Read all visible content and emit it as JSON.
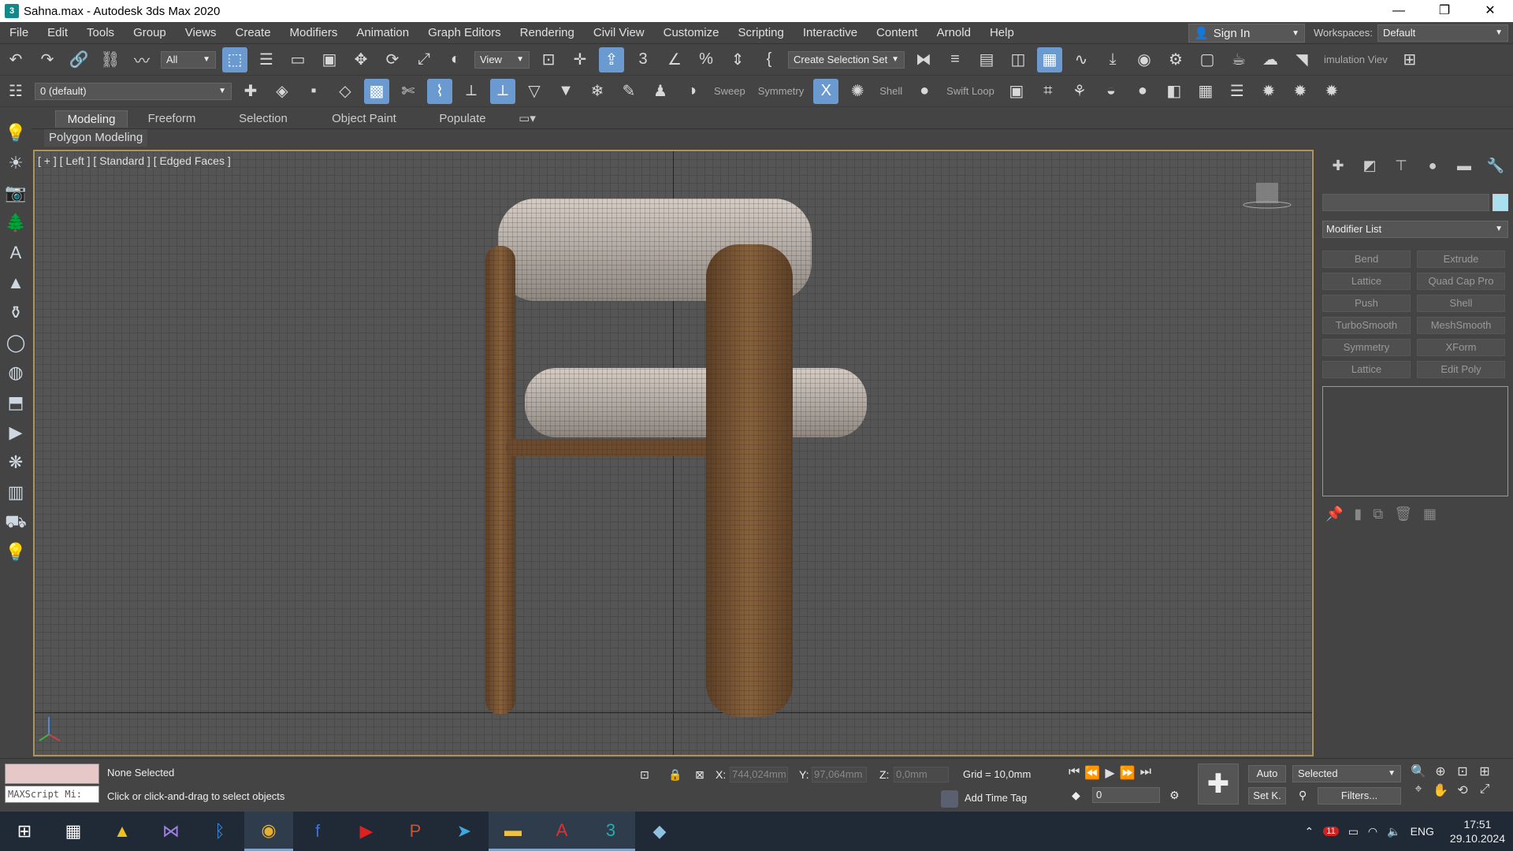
{
  "window": {
    "title": "Sahna.max - Autodesk 3ds Max 2020",
    "app_icon_text": "3",
    "minimize": "—",
    "maximize": "❐",
    "close": "✕"
  },
  "menu": {
    "items": [
      "File",
      "Edit",
      "Tools",
      "Group",
      "Views",
      "Create",
      "Modifiers",
      "Animation",
      "Graph Editors",
      "Rendering",
      "Civil View",
      "Customize",
      "Scripting",
      "Interactive",
      "Content",
      "Arnold",
      "Help"
    ],
    "sign_in": "Sign In",
    "workspaces_label": "Workspaces:",
    "workspace_value": "Default"
  },
  "toolbar1": {
    "selection_filter": "All",
    "reference_coord": "View",
    "create_selection_set": "Create Selection Set",
    "simulation_view": "imulation Viev"
  },
  "toolbar2": {
    "layer": "0 (default)",
    "sweep": "Sweep",
    "symmetry": "Symmetry",
    "shell": "Shell",
    "swift_loop": "Swift Loop"
  },
  "ribbon": {
    "tabs": [
      "Modeling",
      "Freeform",
      "Selection",
      "Object Paint",
      "Populate"
    ],
    "panel_label": "Polygon Modeling"
  },
  "viewport": {
    "label": "[ + ] [ Left ] [ Standard ] [ Edged Faces ]"
  },
  "command_panel": {
    "modifier_list": "Modifier List",
    "modifier_buttons": [
      "Bend",
      "Extrude",
      "Lattice",
      "Quad Cap Pro",
      "Push",
      "Shell",
      "TurboSmooth",
      "MeshSmooth",
      "Symmetry",
      "XForm",
      "Lattice",
      "Edit Poly"
    ]
  },
  "status": {
    "maxscript": "MAXScript Mi:",
    "selection": "None Selected",
    "prompt": "Click or click-and-drag to select objects",
    "x_label": "X:",
    "x_value": "744,024mm",
    "y_label": "Y:",
    "y_value": "97,064mm",
    "z_label": "Z:",
    "z_value": "0,0mm",
    "grid": "Grid = 10,0mm",
    "add_time_tag": "Add Time Tag",
    "frame": "0",
    "auto": "Auto",
    "set_key": "Set K.",
    "selected": "Selected",
    "filters": "Filters..."
  },
  "taskbar": {
    "language": "ENG",
    "time": "17:51",
    "date": "29.10.2024",
    "notification_count": "11"
  },
  "colors": {
    "viewport_border": "#b0955a",
    "active_tool": "#6a9ad0",
    "wood": "#7a5430",
    "cushion": "#b8aea6"
  }
}
